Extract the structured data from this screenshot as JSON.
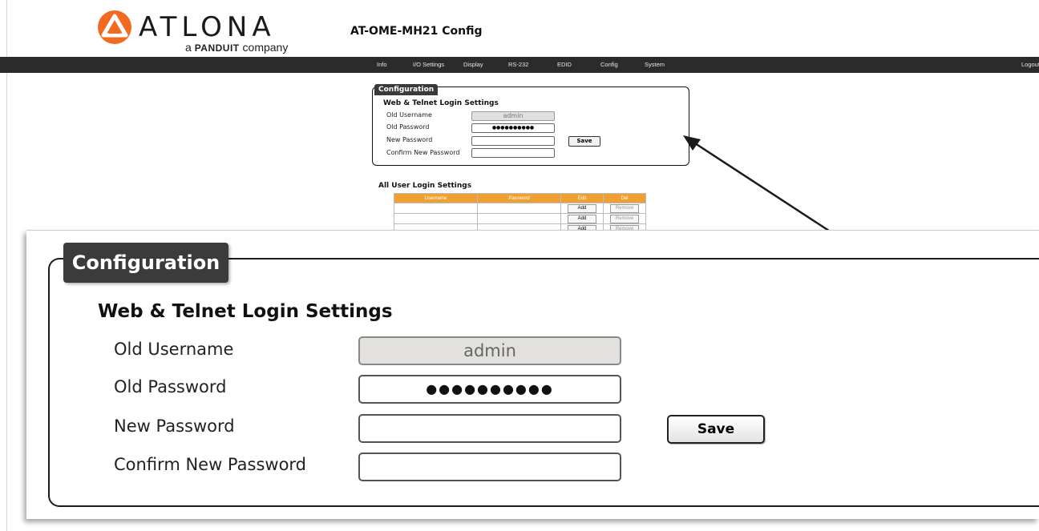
{
  "header": {
    "brand_word": "ATLONA",
    "brand_sub_prefix": "a",
    "brand_sub_name": "PANDUIT",
    "brand_sub_suffix": "company",
    "page_title": "AT-OME-MH21  Config"
  },
  "nav": {
    "items": [
      "Info",
      "I/O Settings",
      "Display",
      "RS-232",
      "EDID",
      "Config",
      "System"
    ],
    "logout": "Logout"
  },
  "config": {
    "tab": "Configuration",
    "heading": "Web & Telnet Login Settings",
    "old_username_label": "Old Username",
    "old_username_value": "admin",
    "old_password_label": "Old Password",
    "old_password_value": "●●●●●●●●●●",
    "new_password_label": "New Password",
    "new_password_value": "",
    "confirm_password_label": "Confirm New Password",
    "confirm_password_value": "",
    "save_label": "Save"
  },
  "users": {
    "heading": "All User Login Settings",
    "columns": [
      "Username",
      "Password",
      "Edit",
      "Del"
    ],
    "add_label": "Add",
    "remove_label": "Remove"
  },
  "colors": {
    "navbar": "#2b2b2b",
    "table_header": "#f0a030",
    "logo_orange": "#f26a1f"
  }
}
